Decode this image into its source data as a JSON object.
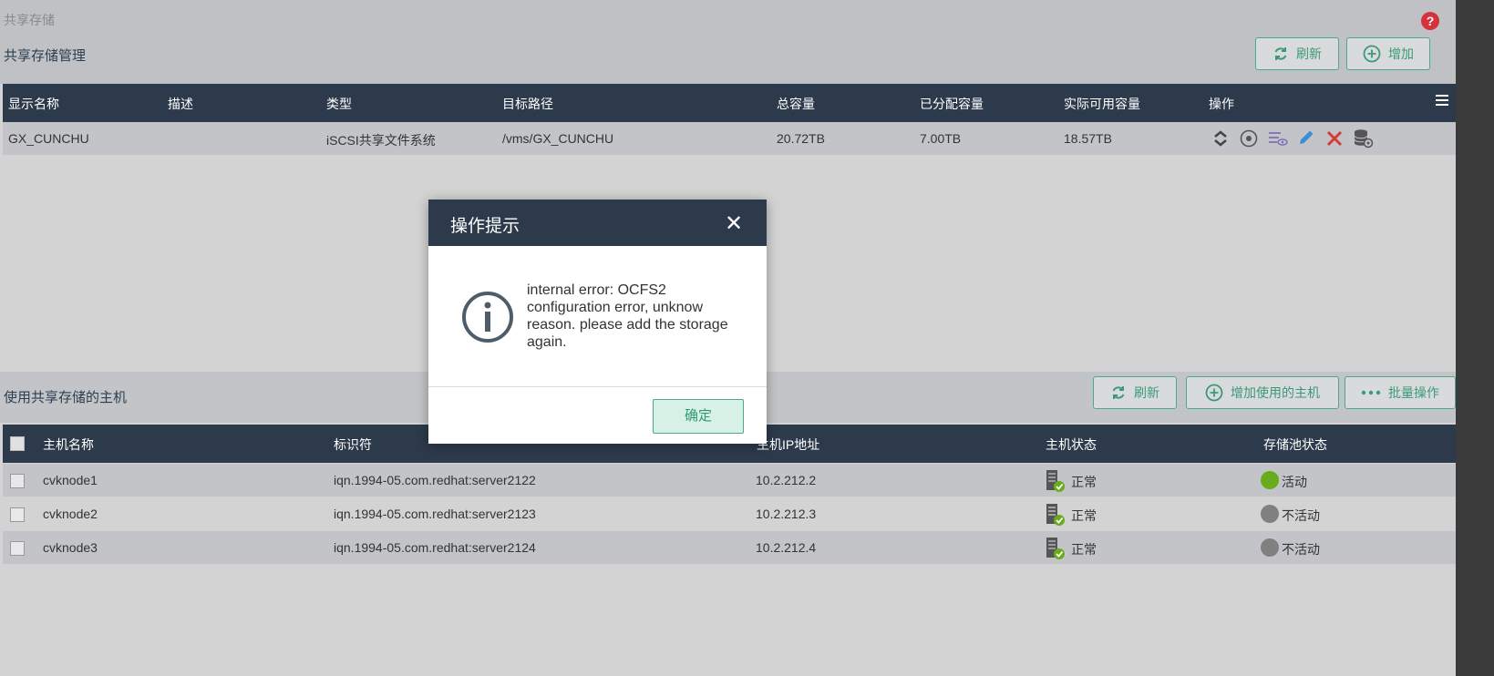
{
  "breadcrumb": "共享存储",
  "help_icon": "question-circle-icon",
  "storage_section": {
    "title": "共享存储管理",
    "refresh_label": "刷新",
    "add_label": "增加",
    "columns": [
      "显示名称",
      "描述",
      "类型",
      "目标路径",
      "总容量",
      "已分配容量",
      "实际可用容量",
      "操作"
    ],
    "rows": [
      {
        "name": "GX_CUNCHU",
        "desc": "",
        "type": "iSCSI共享文件系统",
        "path": "/vms/GX_CUNCHU",
        "total": "20.72TB",
        "allocated": "7.00TB",
        "available": "18.57TB"
      }
    ]
  },
  "hosts_section": {
    "title": "使用共享存储的主机",
    "refresh_label": "刷新",
    "add_host_label": "增加使用的主机",
    "batch_label": "批量操作",
    "columns": [
      "主机名称",
      "标识符",
      "主机IP地址",
      "主机状态",
      "存储池状态"
    ],
    "rows": [
      {
        "name": "cvknode1",
        "id": "iqn.1994-05.com.redhat:server2122",
        "ip": "10.2.212.2",
        "host_status": "正常",
        "pool_status": "活动",
        "pool_color": "#6aab1c"
      },
      {
        "name": "cvknode2",
        "id": "iqn.1994-05.com.redhat:server2123",
        "ip": "10.2.212.3",
        "host_status": "正常",
        "pool_status": "不活动",
        "pool_color": "#808080"
      },
      {
        "name": "cvknode3",
        "id": "iqn.1994-05.com.redhat:server2124",
        "ip": "10.2.212.4",
        "host_status": "正常",
        "pool_status": "不活动",
        "pool_color": "#808080"
      }
    ]
  },
  "dialog": {
    "title": "操作提示",
    "message": "internal error: OCFS2 configuration error, unknow reason. please add the storage again.",
    "ok_label": "确定"
  },
  "colors": {
    "header_bg": "#2d3a4c",
    "accent": "#3a9a78",
    "active": "#6aab1c",
    "inactive": "#808080"
  }
}
